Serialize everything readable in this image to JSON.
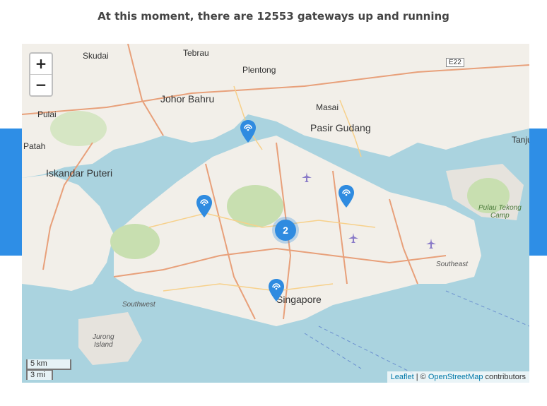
{
  "headline": "At this moment, there are 12553 gateways up and running",
  "map": {
    "zoom_in": "+",
    "zoom_out": "−",
    "scale_km": "5 km",
    "scale_mi": "3 mi",
    "attribution_leaflet": "Leaflet",
    "attribution_sep": " | © ",
    "attribution_osm": "OpenStreetMap",
    "attribution_tail": " contributors",
    "places": {
      "johor_bahru": "Johor Bahru",
      "iskandar_puteri": "Iskandar Puteri",
      "pasir_gudang": "Pasir Gudang",
      "singapore": "Singapore",
      "skudai": "Skudai",
      "tebrau": "Tebrau",
      "plentong": "Plentong",
      "masai": "Masai",
      "pulai": "Pulai",
      "patah": "Patah",
      "tanju": "Tanju",
      "southwest": "Southwest",
      "southeast": "Southeast",
      "jurong_island": "Jurong\nIsland",
      "pulau_tekong": "Pulau Tekong\nCamp",
      "e22": "E22"
    },
    "cluster_count": "2",
    "icons": {
      "pin": "gateway-pin-icon",
      "airport": "airplane-icon"
    },
    "colors": {
      "water": "#aad3df",
      "land": "#f2efe9",
      "park": "#c8dfb0",
      "pin": "#2f8be0",
      "band": "#2e8ee6"
    }
  }
}
